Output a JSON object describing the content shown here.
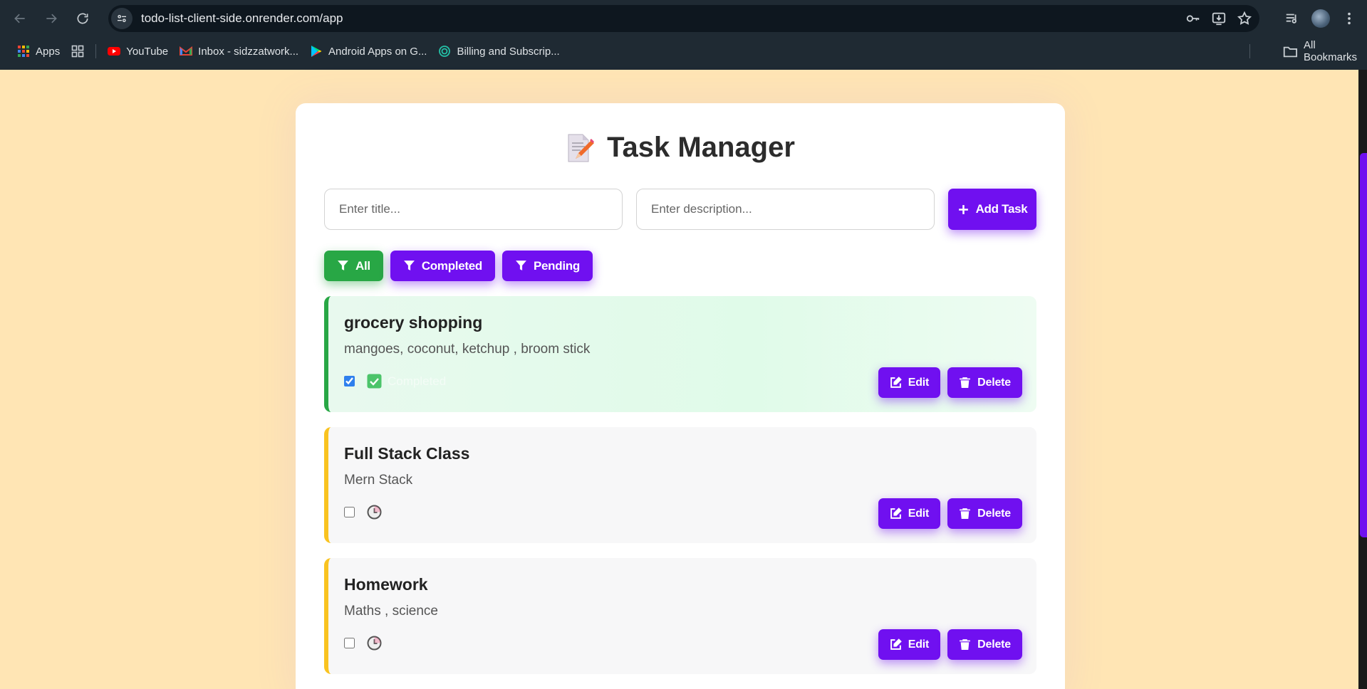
{
  "browser": {
    "url": "todo-list-client-side.onrender.com/app",
    "bookmarks": [
      {
        "label": "Apps",
        "icon": "apps-grid-icon"
      },
      {
        "label": "YouTube",
        "icon": "youtube-icon"
      },
      {
        "label": "Inbox - sidzzatwork...",
        "icon": "gmail-icon"
      },
      {
        "label": "Android Apps on G...",
        "icon": "google-play-icon"
      },
      {
        "label": "Billing and Subscrip...",
        "icon": "billing-icon"
      }
    ],
    "all_bookmarks": "All Bookmarks"
  },
  "app": {
    "title": "Task Manager",
    "title_icon": "memo-pencil-icon",
    "title_placeholder": "Enter title...",
    "description_placeholder": "Enter description...",
    "add_button": "Add Task",
    "filters": [
      {
        "label": "All",
        "active": true
      },
      {
        "label": "Completed",
        "active": false
      },
      {
        "label": "Pending",
        "active": false
      }
    ],
    "tasks": [
      {
        "title": "grocery shopping",
        "description": "mangoes, coconut, ketchup , broom stick",
        "completed": true,
        "status_icon": "check-mark-icon",
        "status_text": "Completed",
        "edit": "Edit",
        "delete": "Delete"
      },
      {
        "title": "Full Stack Class",
        "description": "Mern Stack",
        "completed": false,
        "status_icon": "clock-icon",
        "edit": "Edit",
        "delete": "Delete"
      },
      {
        "title": "Homework",
        "description": "Maths , science",
        "completed": false,
        "status_icon": "clock-icon",
        "edit": "Edit",
        "delete": "Delete"
      }
    ]
  },
  "colors": {
    "page_background": "#ffe5b4",
    "primary_purple": "#7010f0",
    "active_green": "#28a745",
    "pending_yellow": "#f9c320"
  }
}
